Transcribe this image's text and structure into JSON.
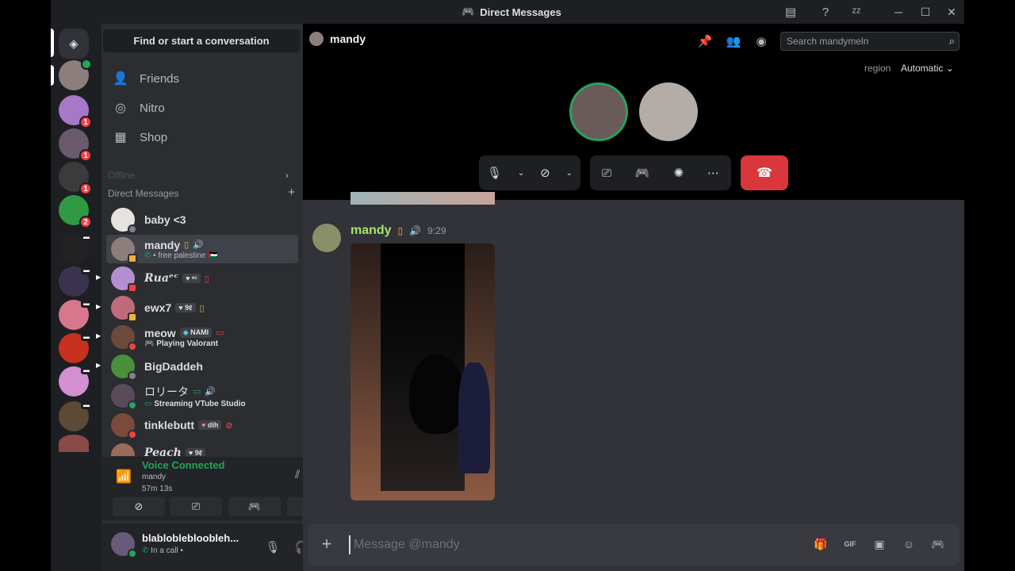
{
  "window": {
    "title": "Direct Messages"
  },
  "sidebar": {
    "search_label": "Find or start a conversation",
    "nav": [
      {
        "label": "Friends",
        "icon": "friends-icon"
      },
      {
        "label": "Nitro",
        "icon": "nitro-icon"
      },
      {
        "label": "Shop",
        "icon": "shop-icon"
      }
    ],
    "faded_label": "Offline",
    "dm_header": "Direct Messages",
    "dms": [
      {
        "name": "baby <3",
        "sub": "",
        "tag": ""
      },
      {
        "name": "mandy",
        "sub": "• free palestine 🇵🇸",
        "tag": ""
      },
      {
        "name": "𝑹𝒖𝒂ᵉᶜ",
        "sub": "",
        "tag": "ᵉᶜ"
      },
      {
        "name": "ewx7",
        "sub": "",
        "tag": "9ℓ"
      },
      {
        "name": "meow",
        "sub": "Playing Valorant",
        "tag": "NAMI"
      },
      {
        "name": "BigDaddeh",
        "sub": "",
        "tag": ""
      },
      {
        "name": "ロリータ",
        "sub": "Streaming VTube Studio",
        "tag": ""
      },
      {
        "name": "tinklebutt",
        "sub": "",
        "tag": "dih"
      },
      {
        "name": "Peach",
        "sub": "",
        "tag": "9ℓ"
      }
    ],
    "voice": {
      "title": "Voice Connected",
      "channel": "mandy",
      "elapsed": "57m 13s"
    },
    "user": {
      "name": "blabloblebloobleh...",
      "status": "In a call •"
    }
  },
  "channel": {
    "name": "mandy",
    "search_placeholder": "Search mandymeln",
    "region_label": "region",
    "region_value": "Automatic"
  },
  "message": {
    "author": "mandy",
    "time": "9:29"
  },
  "composer": {
    "placeholder": "Message @mandy"
  },
  "server_badges": [
    "1",
    "1",
    "1",
    "2"
  ],
  "colors": {
    "accent_green": "#23a55a",
    "danger_red": "#da373c",
    "author_color": "#a8e26b"
  }
}
